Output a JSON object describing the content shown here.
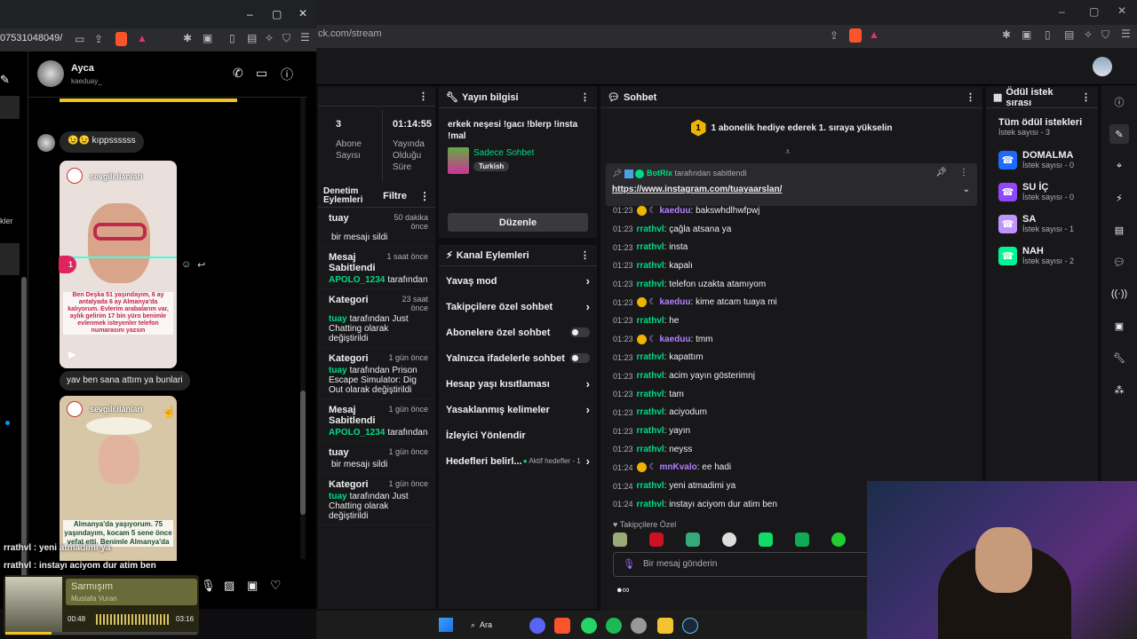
{
  "back_browser": {
    "url": "ck.com/stream"
  },
  "stats": {
    "viewers_value": "3",
    "viewers_label_1": "Abone",
    "viewers_label_2": "Sayısı",
    "uptime_value": "01:14:55",
    "uptime_label_1": "Yayında",
    "uptime_label_2": "Olduğu",
    "uptime_label_3": "Süre"
  },
  "mod_actions": {
    "title_1": "Denetim",
    "title_2": "Eylemleri",
    "filter": "Filtre",
    "items": [
      {
        "title": "tuay",
        "time": "50 dakika önce",
        "desc": "bir mesajı sildi",
        "highlight": ""
      },
      {
        "title": "Mesaj Sabitlendi",
        "time": "1 saat önce",
        "desc": "tarafından",
        "highlight": "APOLO_1234"
      },
      {
        "title": "Kategori",
        "time": "23 saat önce",
        "desc": "tarafından Just Chatting olarak değiştirildi",
        "highlight": "tuay"
      },
      {
        "title": "Kategori",
        "time": "1 gün önce",
        "desc": "tarafından Prison Escape Simulator: Dig Out olarak değiştirildi",
        "highlight": "tuay"
      },
      {
        "title": "Mesaj Sabitlendi",
        "time": "1 gün önce",
        "desc": "tarafından",
        "highlight": "APOLO_1234"
      },
      {
        "title": "tuay",
        "time": "1 gün önce",
        "desc": "bir mesajı sildi",
        "highlight": ""
      },
      {
        "title": "Kategori",
        "time": "1 gün önce",
        "desc": "tarafından Just Chatting olarak değiştirildi",
        "highlight": "tuay"
      }
    ]
  },
  "stream_info": {
    "header": "Yayın bilgisi",
    "title": "erkek neşesi !gacı !blerp !insta !mal",
    "category": "Sadece Sohbet",
    "tag": "Turkish",
    "edit_button": "Düzenle"
  },
  "channel_actions": {
    "header": "Kanal Eylemleri",
    "items": [
      {
        "label": "Yavaş mod",
        "control": "chevron"
      },
      {
        "label": "Takipçilere özel sohbet",
        "control": "chevron"
      },
      {
        "label": "Abonelere özel sohbet",
        "control": "toggle"
      },
      {
        "label": "Yalnızca ifadelerle sohbet",
        "control": "toggle"
      },
      {
        "label": "Hesap yaşı kısıtlaması",
        "control": "chevron"
      },
      {
        "label": "Yasaklanmış kelimeler",
        "control": "chevron"
      },
      {
        "label": "İzleyici Yönlendir",
        "control": "none"
      },
      {
        "label": "Hedefleri belirl...",
        "control": "chevron"
      }
    ],
    "goals_status": "Aktif hedefler - 1"
  },
  "chat": {
    "header": "Sohbet",
    "hype_rank": "1",
    "hype_text": "1 abonelik hediye ederek 1. sıraya yükselin",
    "pinned_by": "BotRix",
    "pinned_suffix": "tarafından sabitlendi",
    "pinned_link": "https://www.instagram.com/tuayaarslan/",
    "mode_label": "Takipçilere Özel",
    "input_placeholder": "Bir mesaj gönderin",
    "messages": [
      {
        "time": "01:23",
        "user": "kaeduu",
        "text": ": bakswhdlhwfpwj",
        "color": "#b57fff",
        "badge": true
      },
      {
        "time": "01:23",
        "user": "rrathvl",
        "text": ": çağla atsana ya",
        "color": "#00db84",
        "badge": false
      },
      {
        "time": "01:23",
        "user": "rrathvl",
        "text": ": insta",
        "color": "#00db84",
        "badge": false
      },
      {
        "time": "01:23",
        "user": "rrathvl",
        "text": ": kapalı",
        "color": "#00db84",
        "badge": false
      },
      {
        "time": "01:23",
        "user": "rrathvl",
        "text": ": telefon uzakta atamıyom",
        "color": "#00db84",
        "badge": false
      },
      {
        "time": "01:23",
        "user": "kaeduu",
        "text": ": kime atcam tuaya mi",
        "color": "#b57fff",
        "badge": true
      },
      {
        "time": "01:23",
        "user": "rrathvl",
        "text": ": he",
        "color": "#00db84",
        "badge": false
      },
      {
        "time": "01:23",
        "user": "kaeduu",
        "text": ": tmm",
        "color": "#b57fff",
        "badge": true
      },
      {
        "time": "01:23",
        "user": "rrathvl",
        "text": ": kapattım",
        "color": "#00db84",
        "badge": false
      },
      {
        "time": "01:23",
        "user": "rrathvl",
        "text": ": acim yayın gösterimnj",
        "color": "#00db84",
        "badge": false
      },
      {
        "time": "01:23",
        "user": "rrathvl",
        "text": ": tam",
        "color": "#00db84",
        "badge": false
      },
      {
        "time": "01:23",
        "user": "rrathvl",
        "text": ": aciyodum",
        "color": "#00db84",
        "badge": false
      },
      {
        "time": "01:23",
        "user": "rrathvl",
        "text": ": yayın",
        "color": "#00db84",
        "badge": false
      },
      {
        "time": "01:23",
        "user": "rrathvl",
        "text": ": neyss",
        "color": "#00db84",
        "badge": false
      },
      {
        "time": "01:24",
        "user": "mnKvalo",
        "text": ": ee hadi",
        "color": "#b57fff",
        "badge": true
      },
      {
        "time": "01:24",
        "user": "rrathvl",
        "text": ": yeni atmadimi ya",
        "color": "#00db84",
        "badge": false
      },
      {
        "time": "01:24",
        "user": "rrathvl",
        "text": ": instayı aciyom dur atim ben",
        "color": "#00db84",
        "badge": false
      }
    ]
  },
  "rewards": {
    "header": "Ödül istek sırası",
    "all_title": "Tüm ödül istekleri",
    "all_count": "İstek sayısı - 3",
    "items": [
      {
        "name": "DOMALMA",
        "count": "İstek sayısı - 0",
        "color": "#1f69ff"
      },
      {
        "name": "SU İÇ",
        "count": "İstek sayısı - 0",
        "color": "#9147ff"
      },
      {
        "name": "SA",
        "count": "İstek sayısı - 1",
        "color": "#bf94ff"
      },
      {
        "name": "NAH",
        "count": "İstek sayısı - 2",
        "color": "#00f593"
      }
    ]
  },
  "instagram": {
    "url": "07531048049/",
    "contact_name": "Ayca",
    "contact_handle": "kaeduay_",
    "msg_1": "😉😉 kıppssssss",
    "post_1_account": "sevgili.ilanlari",
    "post_1_caption": "Ben Deşka 51 yaşındayım, 6 ay antalyada 6 ay Almanya'da kalıyorum. Evlerim arabalarım var, aylık gelirim 17 bin yüro benimle evlenmek isteyenler telefon numarasını yazsın",
    "reaction_count": "1",
    "msg_2": "yav ben sana attım ya bunlari",
    "post_2_account": "sevgili.ilanlari",
    "post_2_caption": "Almanya'da yaşıyorum. 75 yaşındayım, kocam 5 sene önce vefat etti. Benimle Almanya'da",
    "overlay_line_1": "rrathvl : yeni atmadimi ya",
    "overlay_line_2": "rrathvl : instayı aciyom dur atim ben",
    "side_label": "kler"
  },
  "music": {
    "title": "Sarmışım",
    "artist": "Mustafa Vuran",
    "elapsed": "00:48",
    "total": "03:16",
    "progress": 0.24
  },
  "taskbar": {
    "search": "Ara"
  }
}
